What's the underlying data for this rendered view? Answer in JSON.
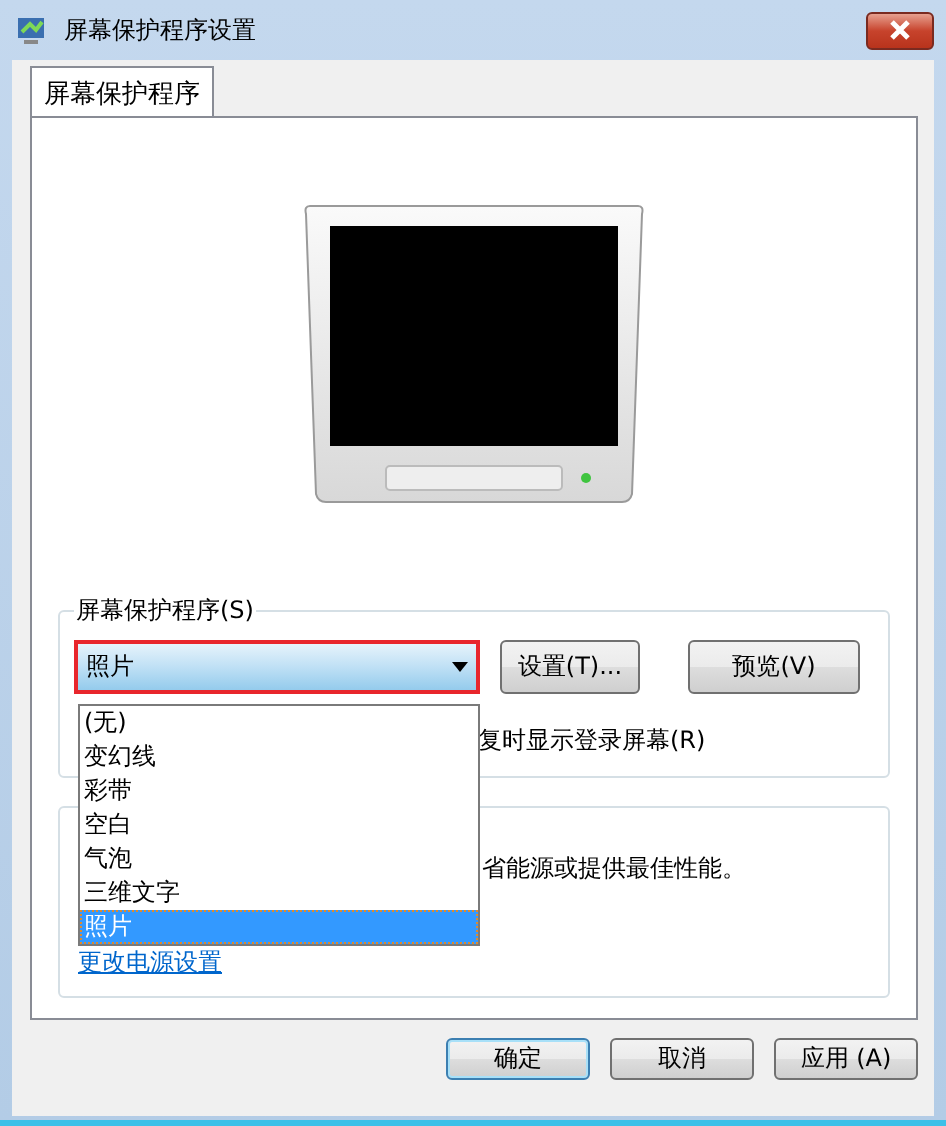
{
  "window": {
    "title": "屏幕保护程序设置"
  },
  "tabs": [
    {
      "label": "屏幕保护程序",
      "selected": true
    }
  ],
  "screensaver_group": {
    "title": "屏幕保护程序(S)",
    "dropdown": {
      "value": "照片",
      "expanded": true,
      "options": [
        {
          "label": "(无)",
          "selected": false
        },
        {
          "label": "变幻线",
          "selected": false
        },
        {
          "label": "彩带",
          "selected": false
        },
        {
          "label": "空白",
          "selected": false
        },
        {
          "label": "气泡",
          "selected": false
        },
        {
          "label": "三维文字",
          "selected": false
        },
        {
          "label": "照片",
          "selected": true
        }
      ]
    },
    "settings_button": "设置(T)...",
    "preview_button": "预览(V)",
    "checkbox_label": "复时显示登录屏幕(R)"
  },
  "power_group": {
    "text": "省能源或提供最佳性能。",
    "link": "更改电源设置"
  },
  "buttons": [
    {
      "label": "确定",
      "default": true
    },
    {
      "label": "取消",
      "default": false
    },
    {
      "label": "应用 (A)",
      "default": false
    }
  ]
}
